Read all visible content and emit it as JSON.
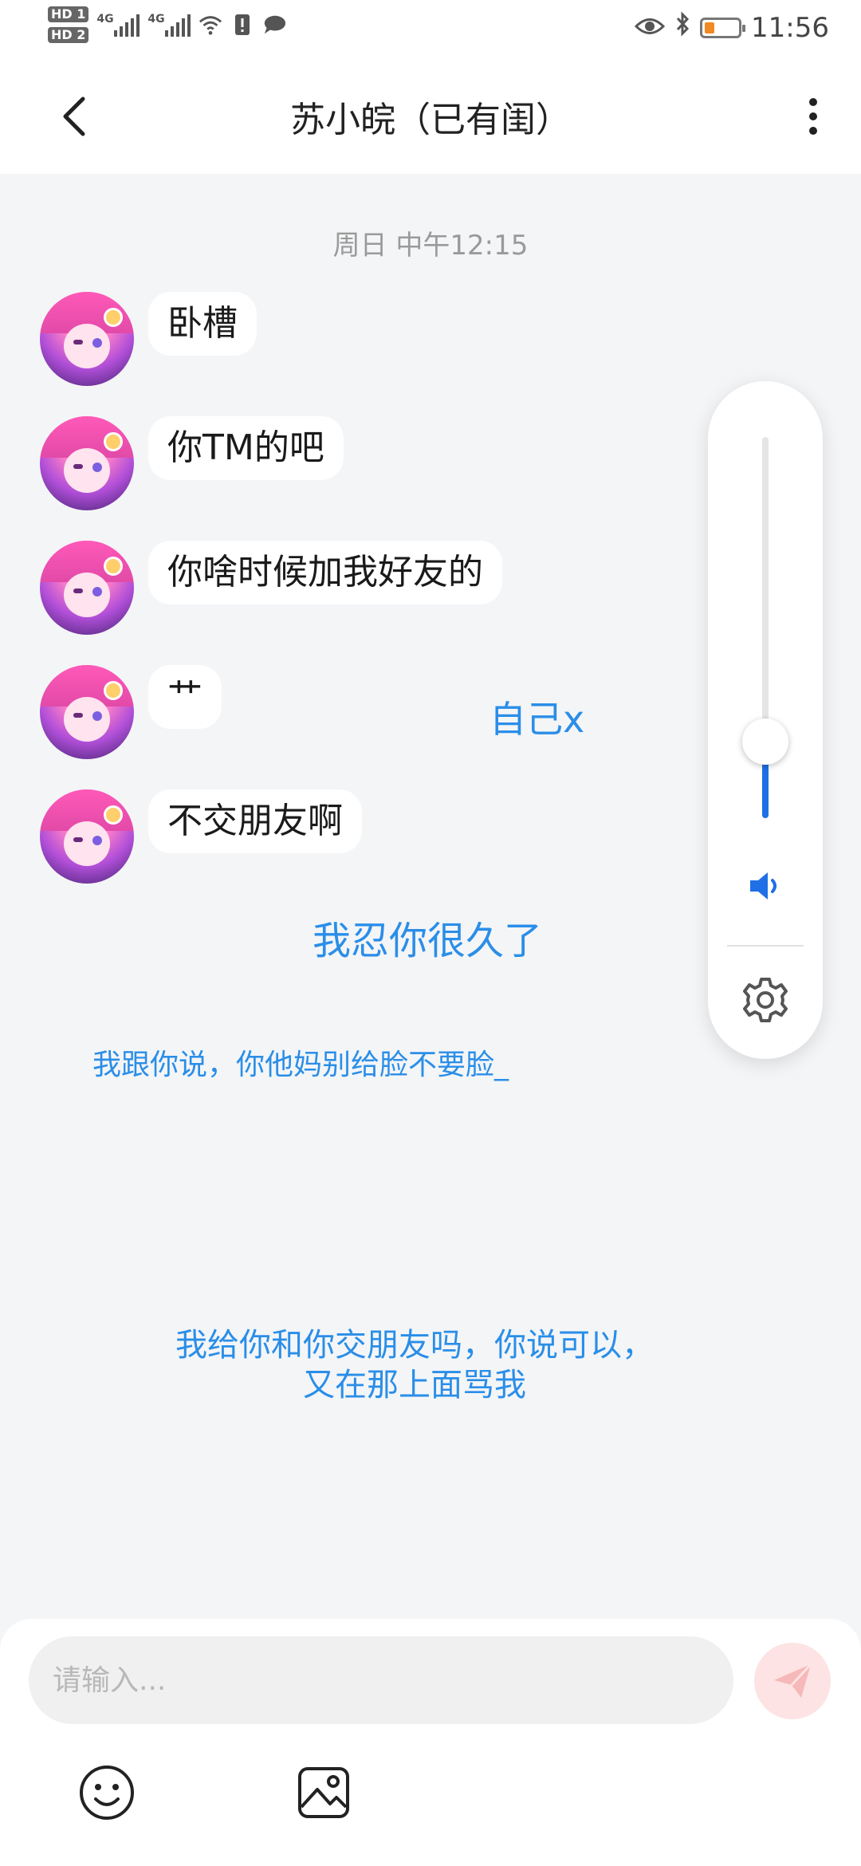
{
  "status_bar": {
    "sim1": "HD 1",
    "sim2": "HD 2",
    "net1": "4G",
    "net2": "4G",
    "time": "11:56",
    "battery_level": 0.2
  },
  "header": {
    "title": "苏小皖（已有闺）"
  },
  "chat": {
    "timestamp": "周日 中午12:15",
    "messages": [
      {
        "text": "卧槽"
      },
      {
        "text": "你TM的吧"
      },
      {
        "text": "你啥时候加我好友的"
      },
      {
        "text": "艹"
      },
      {
        "text": "不交朋友啊"
      }
    ]
  },
  "overlay_texts": {
    "t1": "自己x",
    "t2": "我忍你很久了",
    "t3": "我跟你说，你他妈别给脸不要脸_",
    "t4_line1": "我给你和你交朋友吗，你说可以，",
    "t4_line2": "又在那上面骂我"
  },
  "volume_panel": {
    "level": 0.2
  },
  "input": {
    "placeholder": "请输入..."
  },
  "colors": {
    "overlay_text": "#2a8ee8",
    "volume_accent": "#1f6fe6",
    "send_bg": "#fde3e3"
  }
}
